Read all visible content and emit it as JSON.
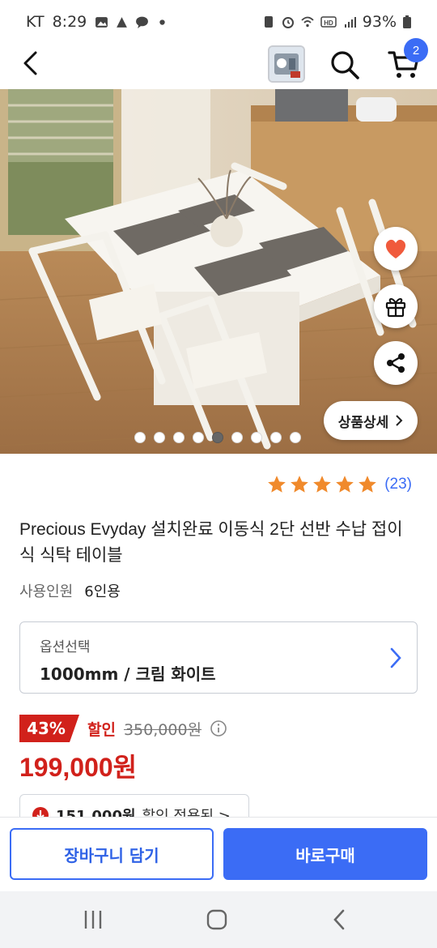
{
  "status_bar": {
    "carrier": "KT",
    "time": "8:29",
    "battery": "93%",
    "notif_icons": [
      "gallery-icon",
      "app-icon",
      "talk-icon",
      "dot-icon"
    ],
    "system_icons": [
      "battery-saver-icon",
      "alarm-icon",
      "wifi-icon",
      "hd-icon",
      "signal-icon",
      "battery-icon"
    ]
  },
  "header": {
    "cart_count": "2",
    "icons": [
      "back-arrow-icon",
      "recent-thumbnail",
      "search-icon",
      "cart-icon"
    ]
  },
  "hero": {
    "detail_button_label": "상품상세",
    "dot_count": 9,
    "active_dot": 5,
    "float_icons": [
      "heart-icon",
      "gift-icon",
      "share-icon"
    ]
  },
  "rating": {
    "stars": 5,
    "review_count": "(23)"
  },
  "product": {
    "title": "Precious Evyday 설치완료 이동식 2단 선반 수납 접이식 식탁 테이블",
    "spec_label": "사용인원",
    "spec_value": "6인용"
  },
  "option": {
    "label": "옵션선택",
    "value": "1000mm / 크림 화이트"
  },
  "price": {
    "discount": "43%",
    "sale_label": "할인",
    "original": "350,000원",
    "final": "199,000원"
  },
  "coupon": {
    "price": "151,000원",
    "text": "할인 적용된 >"
  },
  "actions": {
    "add_to_cart": "장바구니 담기",
    "buy_now": "바로구매"
  },
  "colors": {
    "accent": "#3b6cf5",
    "sale": "#d1211b",
    "star": "#f08a2c"
  }
}
